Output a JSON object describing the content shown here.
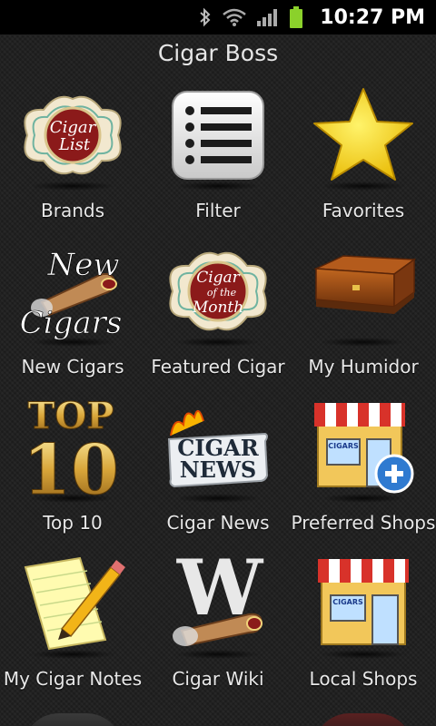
{
  "status": {
    "time": "10:27 PM",
    "icons": [
      "bluetooth-icon",
      "wifi-icon",
      "signal-icon",
      "battery-icon"
    ]
  },
  "app": {
    "title": "Cigar Boss"
  },
  "tiles": [
    {
      "label": "Brands",
      "icon": "cigar-list-badge-icon",
      "badge_text": [
        "Cigar",
        "List"
      ]
    },
    {
      "label": "Filter",
      "icon": "filter-list-icon"
    },
    {
      "label": "Favorites",
      "icon": "star-icon"
    },
    {
      "label": "New Cigars",
      "icon": "new-cigars-icon",
      "badge_text": [
        "New",
        "Cigars"
      ]
    },
    {
      "label": "Featured Cigar",
      "icon": "cigar-of-the-month-badge-icon",
      "badge_text": [
        "Cigar",
        "of the",
        "Month"
      ]
    },
    {
      "label": "My Humidor",
      "icon": "humidor-box-icon"
    },
    {
      "label": "Top 10",
      "icon": "top-10-icon",
      "badge_text": [
        "TOP",
        "10"
      ]
    },
    {
      "label": "Cigar News",
      "icon": "cigar-news-icon",
      "badge_text": [
        "CIGAR",
        "NEWS"
      ]
    },
    {
      "label": "Preferred Shops",
      "icon": "shop-plus-icon",
      "badge_text": [
        "CIGARS"
      ]
    },
    {
      "label": "My Cigar Notes",
      "icon": "notepad-pencil-icon"
    },
    {
      "label": "Cigar Wiki",
      "icon": "wiki-cigar-icon",
      "badge_text": [
        "W"
      ]
    },
    {
      "label": "Local Shops",
      "icon": "shop-icon",
      "badge_text": [
        "CIGARS"
      ]
    }
  ],
  "colors": {
    "background": "#1e1e1e",
    "gold": "#f5d400",
    "badge_red": "#8b1a1a",
    "awning_red": "#d8322a"
  }
}
